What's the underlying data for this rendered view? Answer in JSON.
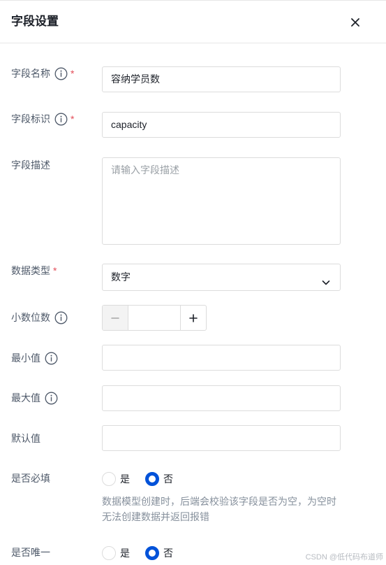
{
  "drawer": {
    "title": "字段设置",
    "close_icon": "close-icon"
  },
  "fields": {
    "name": {
      "label": "字段名称",
      "required": "*",
      "value": "容纳学员数"
    },
    "identifier": {
      "label": "字段标识",
      "required": "*",
      "value": "capacity"
    },
    "description": {
      "label": "字段描述",
      "placeholder": "请输入字段描述",
      "value": ""
    },
    "data_type": {
      "label": "数据类型",
      "required": "*",
      "value": "数字",
      "options": [
        "数字"
      ]
    },
    "decimals": {
      "label": "小数位数",
      "value": "",
      "minus": "−",
      "plus": "+"
    },
    "min_value": {
      "label": "最小值",
      "value": ""
    },
    "max_value": {
      "label": "最大值",
      "value": ""
    },
    "default_value": {
      "label": "默认值",
      "value": ""
    },
    "required_flag": {
      "label": "是否必填",
      "option_yes": "是",
      "option_no": "否",
      "selected": "否",
      "hint": "数据模型创建时，后端会校验该字段是否为空，为空时无法创建数据并返回报错"
    },
    "unique_flag": {
      "label": "是否唯一",
      "option_yes": "是",
      "option_no": "否",
      "selected": "否"
    }
  },
  "watermark": "CSDN @低代码布道师",
  "colors": {
    "primary": "#0052d9",
    "required": "#e34d59",
    "border": "#dcdcdc",
    "label": "#4e5969"
  }
}
